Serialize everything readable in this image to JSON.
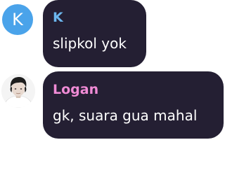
{
  "messages": [
    {
      "avatar_letter": "K",
      "avatar_color": "#4aa3ea",
      "sender": "K",
      "sender_color": "#6cb7ee",
      "text": "slipkol yok"
    },
    {
      "avatar_icon": "user-photo-avatar",
      "sender": "Logan",
      "sender_color": "#f08bd6",
      "text": "gk, suara gua mahal"
    }
  ],
  "colors": {
    "bubble_background": "#241f33",
    "message_text": "#ffffff",
    "page_background": "#ffffff"
  }
}
